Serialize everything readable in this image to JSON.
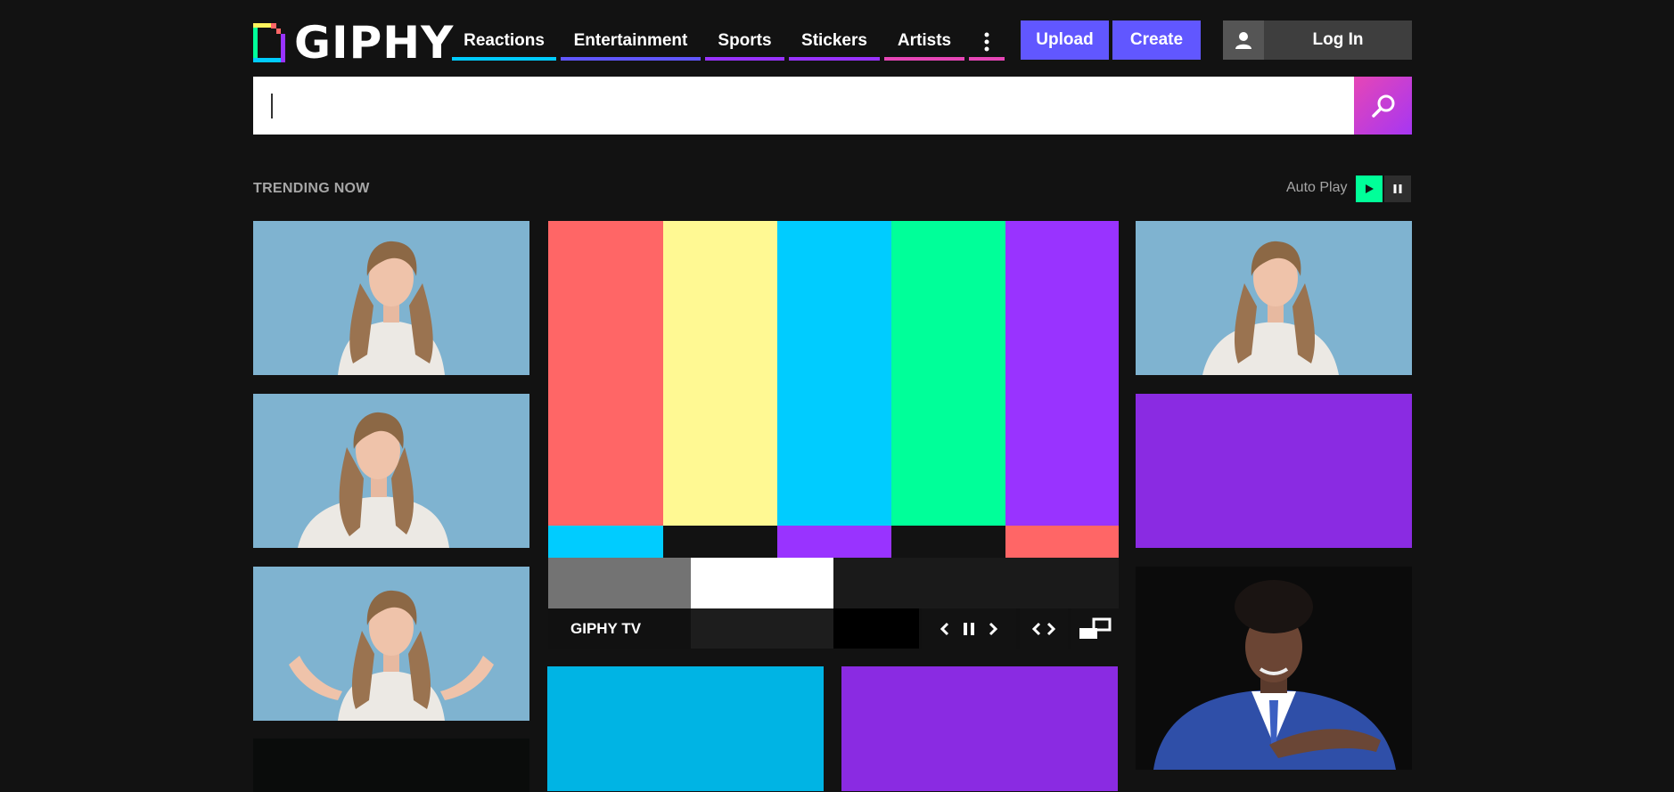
{
  "brand": {
    "name": "GIPHY"
  },
  "nav": {
    "items": [
      {
        "label": "Reactions",
        "color": "#00ccff"
      },
      {
        "label": "Entertainment",
        "color": "#6157ff"
      },
      {
        "label": "Sports",
        "color": "#9933ff"
      },
      {
        "label": "Stickers",
        "color": "#9933ff"
      },
      {
        "label": "Artists",
        "color": "#e646b6"
      }
    ],
    "more_color": "#e646b6"
  },
  "header": {
    "upload_label": "Upload",
    "create_label": "Create",
    "login_label": "Log In"
  },
  "search": {
    "value": "",
    "placeholder": ""
  },
  "trending": {
    "title": "TRENDING NOW",
    "autoplay_label": "Auto Play"
  },
  "tv": {
    "title": "GIPHY TV"
  },
  "colors": {
    "background": "#121212",
    "accent": "#6157ff",
    "tile_blue": "#7fb3d0",
    "tile_purple": "#8a2be2",
    "tile_cyan": "#00b4e4",
    "autoplay_on": "#00ff99"
  }
}
